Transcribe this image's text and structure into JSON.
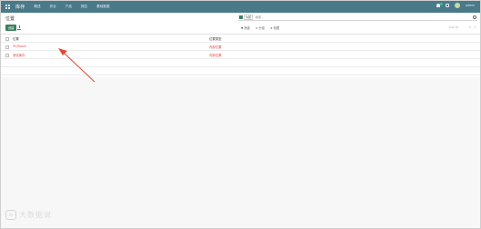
{
  "app": {
    "brand": "库存"
  },
  "nav": {
    "menu": [
      "概述",
      "作业",
      "产品",
      "报告",
      "基础数据"
    ]
  },
  "user": {
    "name": "admin"
  },
  "page": {
    "title": "位置"
  },
  "toolbar": {
    "create_label": "创建"
  },
  "search": {
    "facet": "内部",
    "placeholder": "搜索..."
  },
  "filters": {
    "filter_label": "▼ 筛选",
    "group_label": "≡ 分组",
    "favorite_label": "★ 收藏"
  },
  "pager": {
    "text": "1-2 / 2"
  },
  "table": {
    "headers": [
      "位置",
      "位置类型"
    ],
    "rows": [
      {
        "location": "YC/Stock",
        "type": "内部位置"
      },
      {
        "location": "测试库存",
        "type": "内部位置"
      }
    ]
  },
  "watermark": {
    "text": "大数据说"
  },
  "colors": {
    "nav": "#4a7a89",
    "primary": "#3b8061",
    "row_text": "#e14040",
    "annotation_arrow": "#e04a3a"
  }
}
